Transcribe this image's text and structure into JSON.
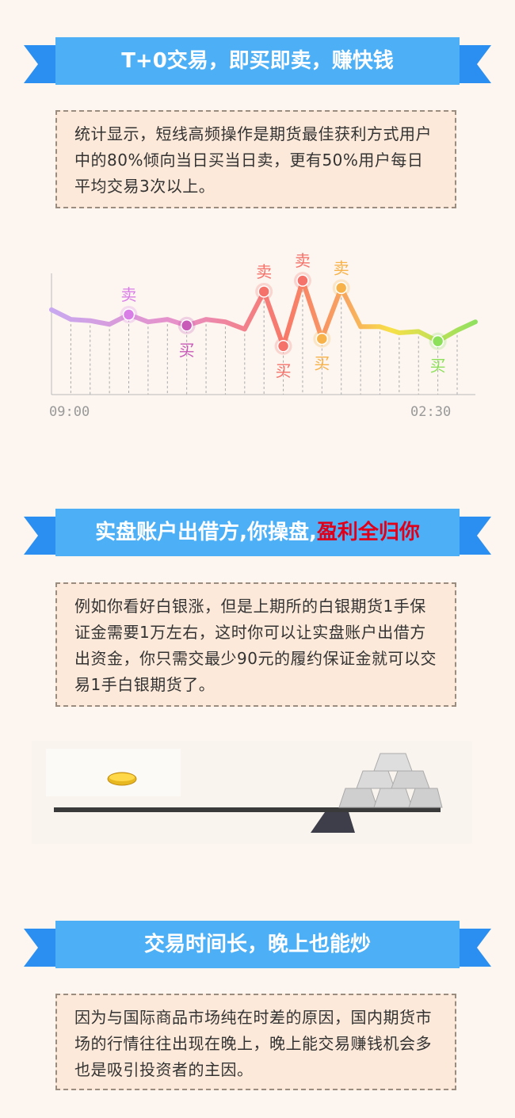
{
  "sections": [
    {
      "title": "T+0交易，即买即卖，赚快钱",
      "text": "统计显示，短线高频操作是期货最佳获利方式用户中的80%倾向当日买当日卖，更有50%用户每日平均交易3次以上。"
    },
    {
      "title": "实盘账户出借方,你操盘,",
      "title_highlight": "盈利全归你",
      "text": "例如你看好白银涨，但是上期所的白银期货1手保证金需要1万左右，这时你可以让实盘账户出借方出资金，你只需交最少90元的履约保证金就可以交易1手白银期货了。"
    },
    {
      "title": "交易时间长，晚上也能炒",
      "text": "因为与国际商品市场纯在时差的原因，国内期货市场的行情往往出现在晚上，晚上能交易赚钱机会多也是吸引投资者的主因。"
    }
  ],
  "chart_data": {
    "type": "line",
    "x_labels": [
      "09:00",
      "02:30"
    ],
    "sell_label": "卖",
    "buy_label": "买",
    "values": [
      70,
      62,
      61,
      58,
      66,
      60,
      62,
      57,
      62,
      60,
      54,
      85,
      40,
      94,
      46,
      88,
      56,
      56,
      51,
      52,
      44,
      53
    ],
    "markers": [
      {
        "index": 4,
        "type": "sell",
        "color": "#d97ee6"
      },
      {
        "index": 7,
        "type": "buy",
        "color": "#c85ab8"
      },
      {
        "index": 11,
        "type": "sell",
        "color": "#f4726a"
      },
      {
        "index": 12,
        "type": "buy",
        "color": "#f4726a"
      },
      {
        "index": 13,
        "type": "sell",
        "color": "#f4726a"
      },
      {
        "index": 14,
        "type": "buy",
        "color": "#f7b24a"
      },
      {
        "index": 15,
        "type": "sell",
        "color": "#f7b24a"
      },
      {
        "index": 20,
        "type": "buy",
        "color": "#8de05a"
      }
    ],
    "colors": [
      "#c8a8f0",
      "#e890c8",
      "#f87868",
      "#f8a860",
      "#f8e048",
      "#90e060"
    ]
  }
}
